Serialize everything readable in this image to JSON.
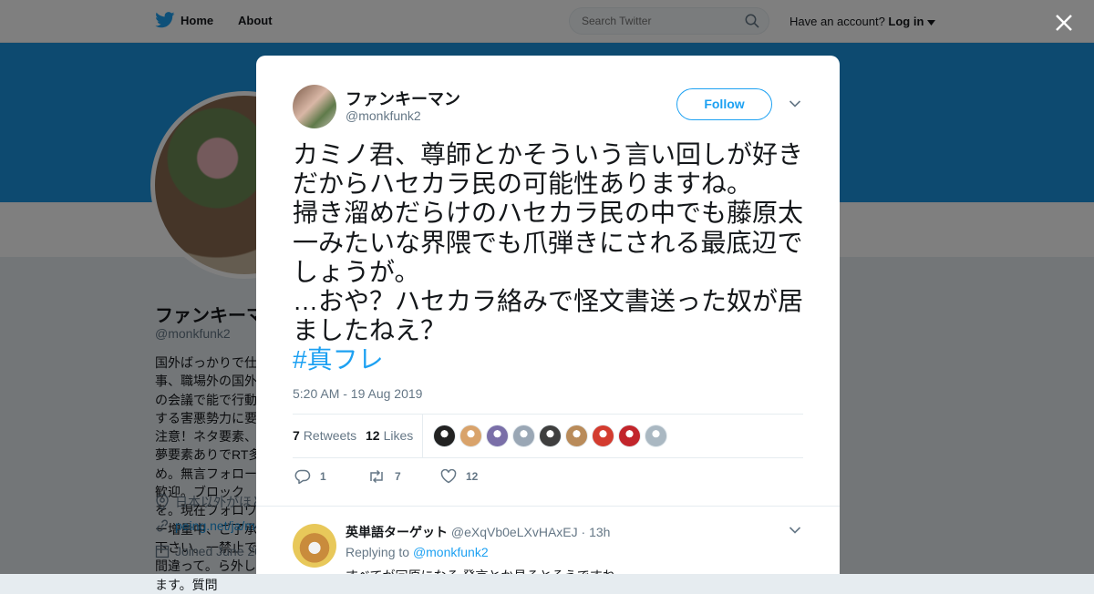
{
  "nav": {
    "home_label": "Home",
    "about_label": "About",
    "search_placeholder": "Search Twitter",
    "account_prompt": "Have an account?",
    "login_label": "Log in"
  },
  "profile": {
    "name": "ファンキーマン",
    "handle": "@monkfunk2",
    "bio": "国外ばっかりで仕事、職場外の国外の会議で能で行動する害悪勢力に要注意！ネタ要素、夢要素ありでRT多め。無言フォロー歓迎。ブロックを。現在フォロワー増量中、ご了承下さい。一禁止で間違って。ら外します。質問",
    "location": "日本以外がほとんど",
    "link": "peing.net/ja/monkfunk2",
    "joined": "Joined June 2019"
  },
  "tweet": {
    "author_name": "ファンキーマン",
    "author_handle": "@monkfunk2",
    "follow_label": "Follow",
    "text": "カミノ君、尊師とかそういう言い回しが好きだからハセカラ民の可能性ありますね。\n掃き溜めだらけのハセカラ民の中でも藤原太一みたいな界隈でも爪弾きにされる最底辺でしょうが。\n…おや？ハセカラ絡みで怪文書送った奴が居ましたねえ？\n",
    "hashtag": "#真フレ",
    "timestamp": "5:20 AM - 19 Aug 2019",
    "retweets_count": "7",
    "retweets_label": "Retweets",
    "likes_count": "12",
    "likes_label": "Likes",
    "reply_action_count": "1",
    "retweet_action_count": "7",
    "like_action_count": "12"
  },
  "likers": [
    {
      "color": "#222222"
    },
    {
      "color": "#d9a36b"
    },
    {
      "color": "#7a6fa8"
    },
    {
      "color": "#9aa7b5"
    },
    {
      "color": "#3f3f3f"
    },
    {
      "color": "#b98b5a"
    },
    {
      "color": "#d33c2f"
    },
    {
      "color": "#c2252b"
    },
    {
      "color": "#aab8c2"
    }
  ],
  "reply": {
    "author_name": "英単語ターゲット",
    "author_handle": "@eXqVb0eLXvHAxEJ",
    "time": "13h",
    "replying_to_label": "Replying to",
    "replying_to_handle": "@monkfunk2",
    "text": "すべてが冗原になる 発言とか見るとそうですね"
  },
  "colors": {
    "accent": "#1da1f2",
    "banner": "#1b95e0",
    "overlay": "rgba(0,0,0,0.5)"
  }
}
